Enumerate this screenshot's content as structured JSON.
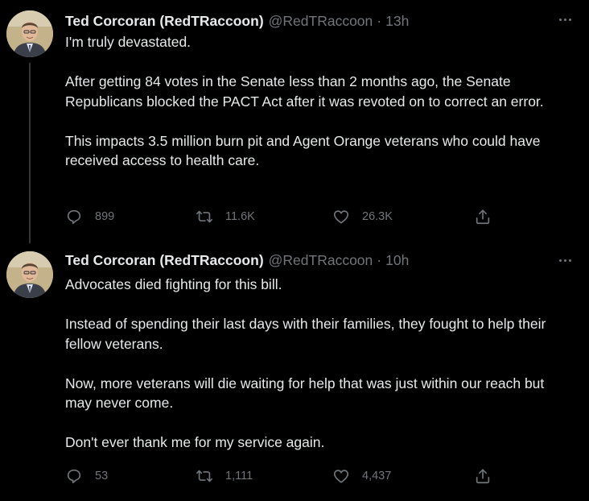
{
  "tweets": [
    {
      "author_name": "Ted Corcoran (RedTRaccoon)",
      "handle": "@RedTRaccoon",
      "separator": "·",
      "time": "13h",
      "paragraphs": [
        "I'm truly devastated.",
        "After getting 84 votes in the Senate less than 2 months ago, the Senate Republicans blocked the PACT Act after it was revoted on to correct an error.",
        "This impacts 3.5 million burn pit and Agent Orange veterans who could have received access to health care."
      ],
      "replies": "899",
      "retweets": "11.6K",
      "likes": "26.3K"
    },
    {
      "author_name": "Ted Corcoran (RedTRaccoon)",
      "handle": "@RedTRaccoon",
      "separator": "·",
      "time": "10h",
      "paragraphs": [
        "Advocates died fighting for this bill.",
        "Instead of spending their last days with their families, they fought to help their fellow veterans.",
        "Now, more veterans will die waiting for help that was just within our reach but may never come.",
        "Don't ever thank me for my service again."
      ],
      "replies": "53",
      "retweets": "1,111",
      "likes": "4,437"
    }
  ],
  "icons": {
    "reply": "reply-icon",
    "retweet": "retweet-icon",
    "like": "heart-icon",
    "share": "share-icon",
    "more": "more-options-icon",
    "avatar": "avatar"
  },
  "colors": {
    "background": "#000000",
    "text_primary": "#e7e9ea",
    "text_secondary": "#71767b",
    "thread_line": "#333639"
  }
}
